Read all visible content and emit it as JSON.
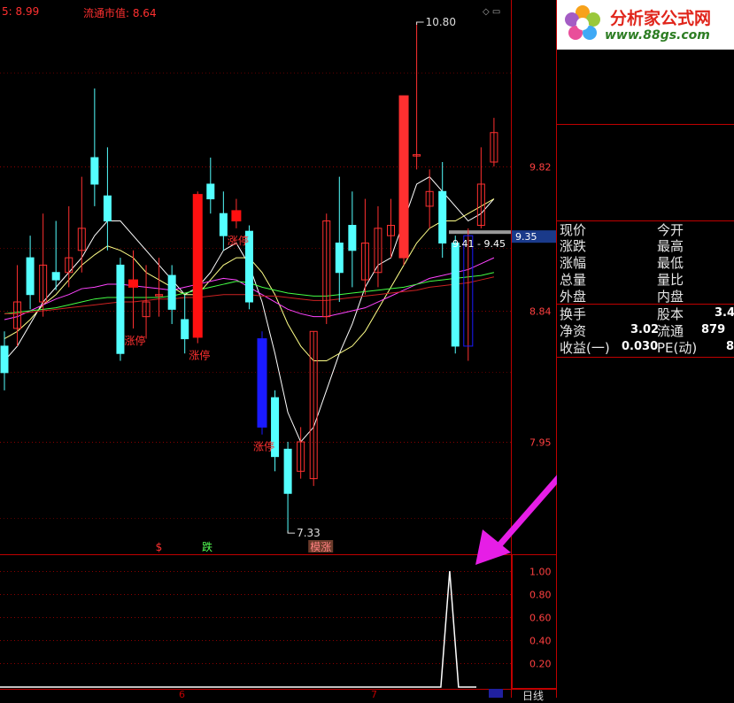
{
  "header": {
    "left_label": "5: 8.99",
    "float_cap_label": "流通市值: 8.64"
  },
  "logo": {
    "name": "分析家公式网",
    "url": "www.88gs.com"
  },
  "quote_panel": {
    "rows": [
      {
        "l1": "现价",
        "l2": "今开",
        "v": ""
      },
      {
        "l1": "涨跌",
        "l2": "最高",
        "v": ""
      },
      {
        "l1": "涨幅",
        "l2": "最低",
        "v": ""
      },
      {
        "l1": "总量",
        "l2": "量比",
        "v": ""
      },
      {
        "l1": "外盘",
        "l2": "内盘",
        "v": ""
      }
    ],
    "rows2": [
      {
        "l1": "换手",
        "v1": "",
        "l2": "股本",
        "v2": "3.4"
      },
      {
        "l1": "净资",
        "v1": "3.02",
        "l2": "流通",
        "v2": "879"
      },
      {
        "l1": "收益(一)",
        "v1": "0.030",
        "l2": "PE(动)",
        "v2": "8"
      }
    ]
  },
  "bottom": {
    "month_labels": [
      "6",
      "7"
    ],
    "period_label": "日线"
  },
  "chart_data": {
    "type": "candlestick",
    "price_axis": {
      "ticks": [
        9.82,
        8.84,
        7.95
      ],
      "current": 9.35,
      "ylim": [
        6.9,
        10.95
      ]
    },
    "annotations": {
      "high": 10.8,
      "low": 7.33,
      "range_label": "9.41 - 9.45",
      "limit_up_label": "涨停",
      "limit_up_indices": [
        10,
        15,
        18,
        20
      ],
      "signal_labels": [
        {
          "text": "$",
          "index": 10
        },
        {
          "text": "跌",
          "index": 13
        },
        {
          "text": "模涨",
          "index": 20
        }
      ]
    },
    "candles": [
      {
        "o": 8.6,
        "c": 8.42,
        "h": 8.7,
        "l": 8.3
      },
      {
        "o": 8.72,
        "c": 8.9,
        "h": 9.15,
        "l": 8.6
      },
      {
        "o": 9.2,
        "c": 8.95,
        "h": 9.35,
        "l": 8.85
      },
      {
        "o": 8.9,
        "c": 9.15,
        "h": 9.5,
        "l": 8.8
      },
      {
        "o": 9.1,
        "c": 9.05,
        "h": 9.45,
        "l": 8.98
      },
      {
        "o": 9.1,
        "c": 9.2,
        "h": 9.55,
        "l": 9.0
      },
      {
        "o": 9.25,
        "c": 9.4,
        "h": 9.75,
        "l": 9.1
      },
      {
        "o": 9.88,
        "c": 9.7,
        "h": 10.35,
        "l": 9.55
      },
      {
        "o": 9.62,
        "c": 9.45,
        "h": 9.95,
        "l": 9.25
      },
      {
        "o": 9.15,
        "c": 8.55,
        "h": 9.2,
        "l": 8.5
      },
      {
        "o": 9.0,
        "c": 9.05,
        "h": 9.25,
        "l": 8.72
      },
      {
        "o": 8.8,
        "c": 8.9,
        "h": 9.15,
        "l": 8.65
      },
      {
        "o": 8.95,
        "c": 8.95,
        "h": 9.2,
        "l": 8.8
      },
      {
        "o": 9.08,
        "c": 8.85,
        "h": 9.15,
        "l": 8.75
      },
      {
        "o": 8.78,
        "c": 8.65,
        "h": 8.95,
        "l": 8.55
      },
      {
        "o": 8.66,
        "c": 9.63,
        "h": 9.65,
        "l": 8.62
      },
      {
        "o": 9.7,
        "c": 9.6,
        "h": 9.88,
        "l": 9.5
      },
      {
        "o": 9.5,
        "c": 9.35,
        "h": 9.65,
        "l": 9.25
      },
      {
        "o": 9.45,
        "c": 9.52,
        "h": 9.6,
        "l": 9.4
      },
      {
        "o": 9.38,
        "c": 8.9,
        "h": 9.42,
        "l": 8.85
      },
      {
        "o": 8.65,
        "c": 8.05,
        "h": 8.7,
        "l": 8.0
      },
      {
        "o": 8.25,
        "c": 7.85,
        "h": 8.3,
        "l": 7.75
      },
      {
        "o": 7.9,
        "c": 7.6,
        "h": 7.95,
        "l": 7.33
      },
      {
        "o": 7.75,
        "c": 7.95,
        "h": 8.05,
        "l": 7.7
      },
      {
        "o": 7.7,
        "c": 8.7,
        "h": 8.7,
        "l": 7.65
      },
      {
        "o": 8.8,
        "c": 9.45,
        "h": 9.5,
        "l": 8.75
      },
      {
        "o": 9.3,
        "c": 9.1,
        "h": 9.75,
        "l": 8.9
      },
      {
        "o": 9.42,
        "c": 9.25,
        "h": 9.65,
        "l": 9.0
      },
      {
        "o": 9.05,
        "c": 9.3,
        "h": 9.6,
        "l": 8.95
      },
      {
        "o": 9.1,
        "c": 9.4,
        "h": 9.55,
        "l": 9.0
      },
      {
        "o": 9.35,
        "c": 9.42,
        "h": 9.6,
        "l": 9.2
      },
      {
        "o": 9.2,
        "c": 10.3,
        "h": 10.3,
        "l": 9.15
      },
      {
        "o": 9.9,
        "c": 9.9,
        "h": 10.8,
        "l": 9.8
      },
      {
        "o": 9.55,
        "c": 9.65,
        "h": 9.8,
        "l": 9.4
      },
      {
        "o": 9.65,
        "c": 9.3,
        "h": 9.85,
        "l": 9.2
      },
      {
        "o": 9.3,
        "c": 8.6,
        "h": 9.35,
        "l": 8.55
      },
      {
        "o": 8.6,
        "c": 9.35,
        "h": 9.4,
        "l": 8.5
      },
      {
        "o": 9.42,
        "c": 9.7,
        "h": 9.95,
        "l": 9.4
      },
      {
        "o": 9.85,
        "c": 10.05,
        "h": 10.15,
        "l": 9.82
      }
    ],
    "ma_series": [
      {
        "color": "#ffffff",
        "values": [
          8.5,
          8.6,
          8.75,
          8.9,
          9.0,
          9.1,
          9.2,
          9.35,
          9.45,
          9.45,
          9.35,
          9.25,
          9.15,
          9.05,
          8.95,
          9.0,
          9.1,
          9.25,
          9.3,
          9.15,
          8.9,
          8.55,
          8.15,
          7.95,
          8.05,
          8.3,
          8.55,
          8.75,
          9.0,
          9.15,
          9.2,
          9.45,
          9.7,
          9.75,
          9.65,
          9.55,
          9.45,
          9.5,
          9.6
        ]
      },
      {
        "color": "#ffff88",
        "values": [
          8.65,
          8.7,
          8.78,
          8.88,
          8.95,
          9.05,
          9.15,
          9.22,
          9.28,
          9.25,
          9.2,
          9.1,
          9.05,
          9.0,
          8.95,
          8.95,
          9.05,
          9.15,
          9.2,
          9.2,
          9.1,
          8.95,
          8.75,
          8.6,
          8.5,
          8.5,
          8.55,
          8.6,
          8.7,
          8.85,
          9.0,
          9.15,
          9.3,
          9.4,
          9.45,
          9.45,
          9.5,
          9.55,
          9.6
        ]
      },
      {
        "color": "#ff44ff",
        "values": [
          8.78,
          8.8,
          8.84,
          8.88,
          8.92,
          8.95,
          8.99,
          9.0,
          9.02,
          9.02,
          9.01,
          9.0,
          8.99,
          8.98,
          9.0,
          9.02,
          9.04,
          9.06,
          9.05,
          9.0,
          8.95,
          8.9,
          8.85,
          8.82,
          8.8,
          8.8,
          8.82,
          8.84,
          8.86,
          8.9,
          8.94,
          8.98,
          9.02,
          9.06,
          9.08,
          9.1,
          9.12,
          9.16,
          9.2
        ]
      },
      {
        "color": "#44ff44",
        "values": [
          8.82,
          8.83,
          8.84,
          8.85,
          8.86,
          8.88,
          8.9,
          8.92,
          8.93,
          8.93,
          8.93,
          8.93,
          8.93,
          8.94,
          8.96,
          8.98,
          9.0,
          9.02,
          9.04,
          9.03,
          9.0,
          8.98,
          8.96,
          8.95,
          8.94,
          8.94,
          8.95,
          8.96,
          8.97,
          8.98,
          8.99,
          9.0,
          9.02,
          9.04,
          9.05,
          9.06,
          9.07,
          9.08,
          9.1
        ]
      },
      {
        "color": "#cc2222",
        "values": [
          8.82,
          8.82,
          8.83,
          8.84,
          8.85,
          8.86,
          8.87,
          8.88,
          8.89,
          8.9,
          8.9,
          8.91,
          8.92,
          8.92,
          8.93,
          8.93,
          8.94,
          8.95,
          8.95,
          8.95,
          8.94,
          8.94,
          8.93,
          8.92,
          8.91,
          8.91,
          8.92,
          8.93,
          8.94,
          8.95,
          8.96,
          8.97,
          8.98,
          9.0,
          9.01,
          9.02,
          9.03,
          9.05,
          9.07
        ]
      }
    ],
    "indicator": {
      "ticks": [
        1.0,
        0.8,
        0.6,
        0.4,
        0.2
      ],
      "signal_index": 38,
      "signal_value": 1.0,
      "ylim": [
        0,
        1.05
      ]
    }
  }
}
